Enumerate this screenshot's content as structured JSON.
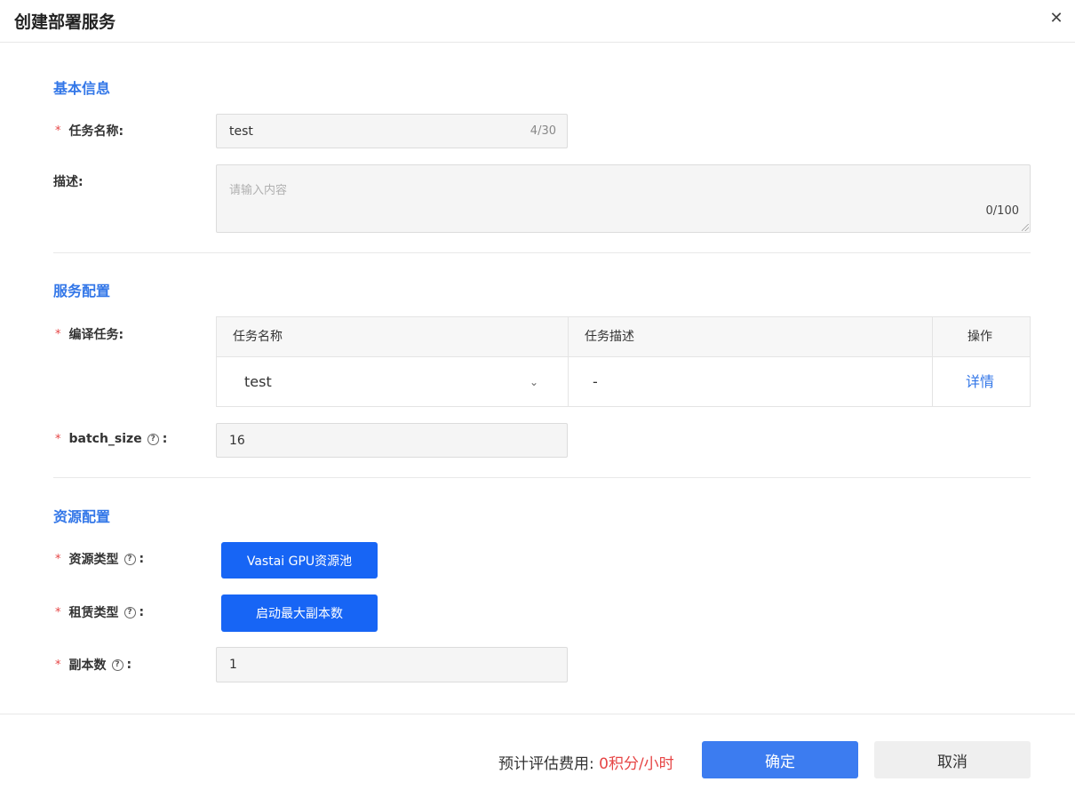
{
  "dialog": {
    "title": "创建部署服务",
    "close_glyph": "✕"
  },
  "basic": {
    "section_title": "基本信息",
    "task_name": {
      "label": "任务名称:",
      "value": "test",
      "count": "4/30"
    },
    "description": {
      "label": "描述:",
      "placeholder": "请输入内容",
      "count": "0/100"
    }
  },
  "service": {
    "section_title": "服务配置",
    "compile_task": {
      "label": "编译任务:",
      "columns": [
        "任务名称",
        "任务描述",
        "操作"
      ],
      "row": {
        "name": "test",
        "desc": "-",
        "action": "详情"
      }
    },
    "batch_size": {
      "label": "batch_size",
      "colon": ":",
      "value": "16"
    }
  },
  "resource": {
    "section_title": "资源配置",
    "resource_type": {
      "label": "资源类型",
      "colon": ":",
      "button": "Vastai GPU资源池"
    },
    "lease_type": {
      "label": "租赁类型",
      "colon": ":",
      "button": "启动最大副本数"
    },
    "replicas": {
      "label": "副本数",
      "colon": ":",
      "value": "1"
    }
  },
  "footer": {
    "fee_label": "预计评估费用: ",
    "fee_value": "0积分/小时",
    "ok_label": "确定",
    "cancel_label": "取消"
  },
  "required_mark": "*",
  "help_glyph": "?",
  "chevron_glyph": "⌄",
  "colors": {
    "accent": "#1765f5",
    "section": "#3377e8",
    "required": "#e64545"
  }
}
